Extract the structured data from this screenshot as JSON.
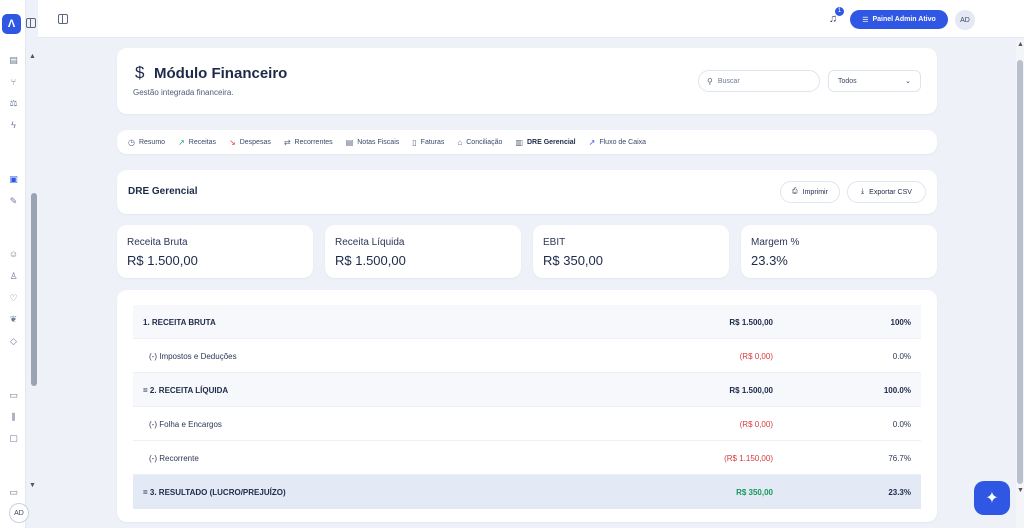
{
  "rail": {
    "logo": "Λ",
    "avatar": "AD"
  },
  "topbar": {
    "notification_count": "1",
    "admin_pill": "Painel Admin Ativo",
    "avatar": "AD"
  },
  "header": {
    "icon": "$",
    "title": "Módulo Financeiro",
    "subtitle": "Gestão integrada financeira.",
    "search_placeholder": "Buscar",
    "filter_value": "Todos"
  },
  "tabs": [
    {
      "label": "Resumo",
      "icon": "clock-icon"
    },
    {
      "label": "Receitas",
      "icon": "trend-up-icon"
    },
    {
      "label": "Despesas",
      "icon": "trend-down-icon"
    },
    {
      "label": "Recorrentes",
      "icon": "repeat-icon"
    },
    {
      "label": "Notas Fiscais",
      "icon": "receipt-icon"
    },
    {
      "label": "Faturas",
      "icon": "file-icon"
    },
    {
      "label": "Conciliação",
      "icon": "bank-icon"
    },
    {
      "label": "DRE Gerencial",
      "icon": "bar-chart-icon",
      "active": true
    },
    {
      "label": "Fluxo de Caixa",
      "icon": "trend-up-icon"
    }
  ],
  "dre": {
    "title": "DRE Gerencial",
    "print_label": "Imprimir",
    "export_label": "Exportar CSV"
  },
  "kpis": [
    {
      "label": "Receita Bruta",
      "value": "R$ 1.500,00"
    },
    {
      "label": "Receita Líquida",
      "value": "R$ 1.500,00"
    },
    {
      "label": "EBIT",
      "value": "R$ 350,00"
    },
    {
      "label": "Margem %",
      "value": "23.3%"
    }
  ],
  "table": [
    {
      "label": "1. RECEITA BRUTA",
      "amount": "R$ 1.500,00",
      "pct": "100%"
    },
    {
      "label": "(-) Impostos e Deduções",
      "amount": "(R$ 0,00)",
      "pct": "0.0%"
    },
    {
      "label": "= 2. RECEITA LÍQUIDA",
      "amount": "R$ 1.500,00",
      "pct": "100.0%"
    },
    {
      "label": "(-) Folha e Encargos",
      "amount": "(R$ 0,00)",
      "pct": "0.0%"
    },
    {
      "label": "(-) Recorrente",
      "amount": "(R$ 1.150,00)",
      "pct": "76.7%"
    },
    {
      "label": "= 3. RESULTADO (LUCRO/PREJUÍZO)",
      "amount": "R$ 350,00",
      "pct": "23.3%"
    }
  ],
  "colors": {
    "accent": "#2f57e4",
    "negative": "#d63b3b",
    "positive": "#17985a"
  }
}
